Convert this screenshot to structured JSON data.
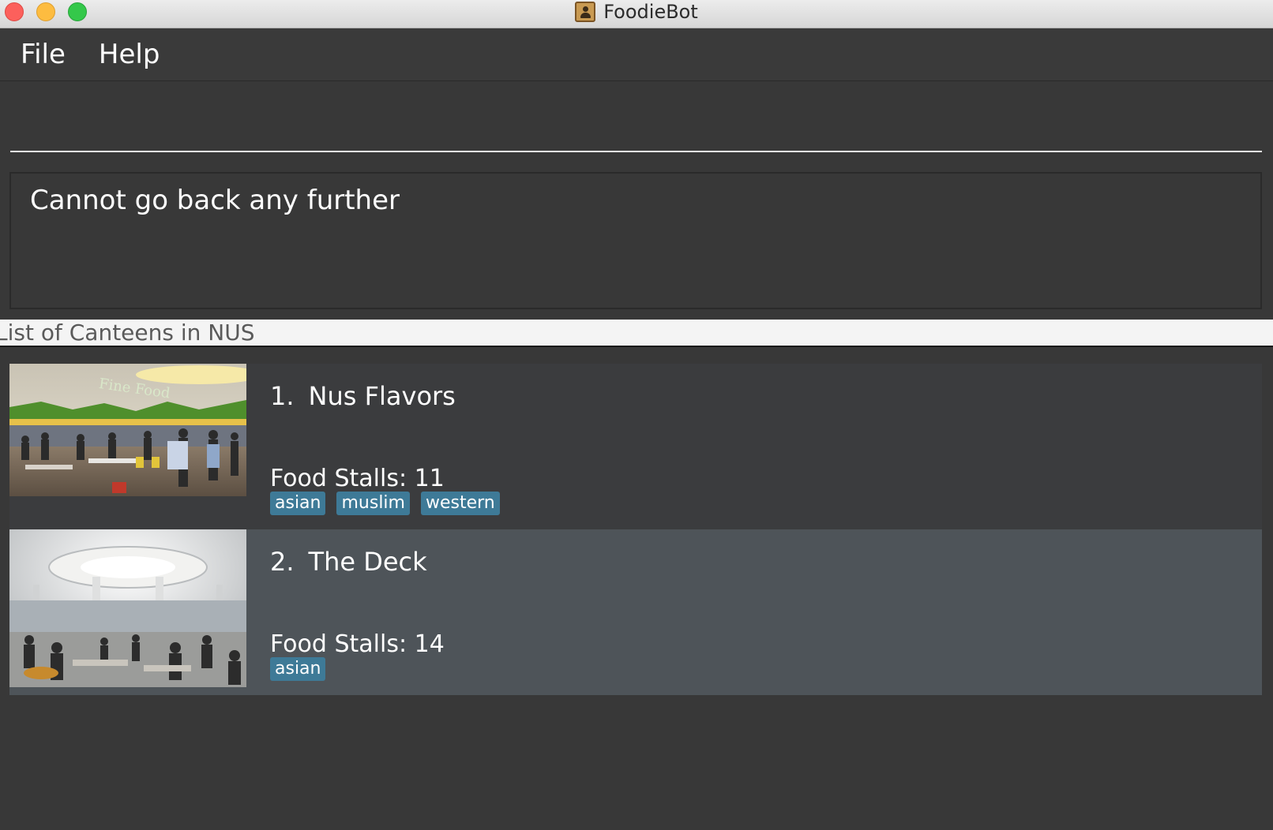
{
  "window": {
    "title": "FoodieBot"
  },
  "menu": {
    "items": [
      "File",
      "Help"
    ]
  },
  "command": {
    "value": ""
  },
  "result": {
    "text": "Cannot go back any further"
  },
  "list": {
    "header": "List of Canteens in NUS",
    "canteens": [
      {
        "index": "1.",
        "name": "Nus Flavors",
        "stalls_label": "Food Stalls: 11",
        "tags": [
          "asian",
          "muslim",
          "western"
        ]
      },
      {
        "index": "2.",
        "name": "The Deck",
        "stalls_label": "Food Stalls: 14",
        "tags": [
          "asian"
        ]
      }
    ]
  },
  "images": {
    "canteen_1_sign": "Fine Food"
  },
  "colors": {
    "tag": "#3e7a97",
    "selected_row": "#4e5459",
    "background": "#383838"
  }
}
